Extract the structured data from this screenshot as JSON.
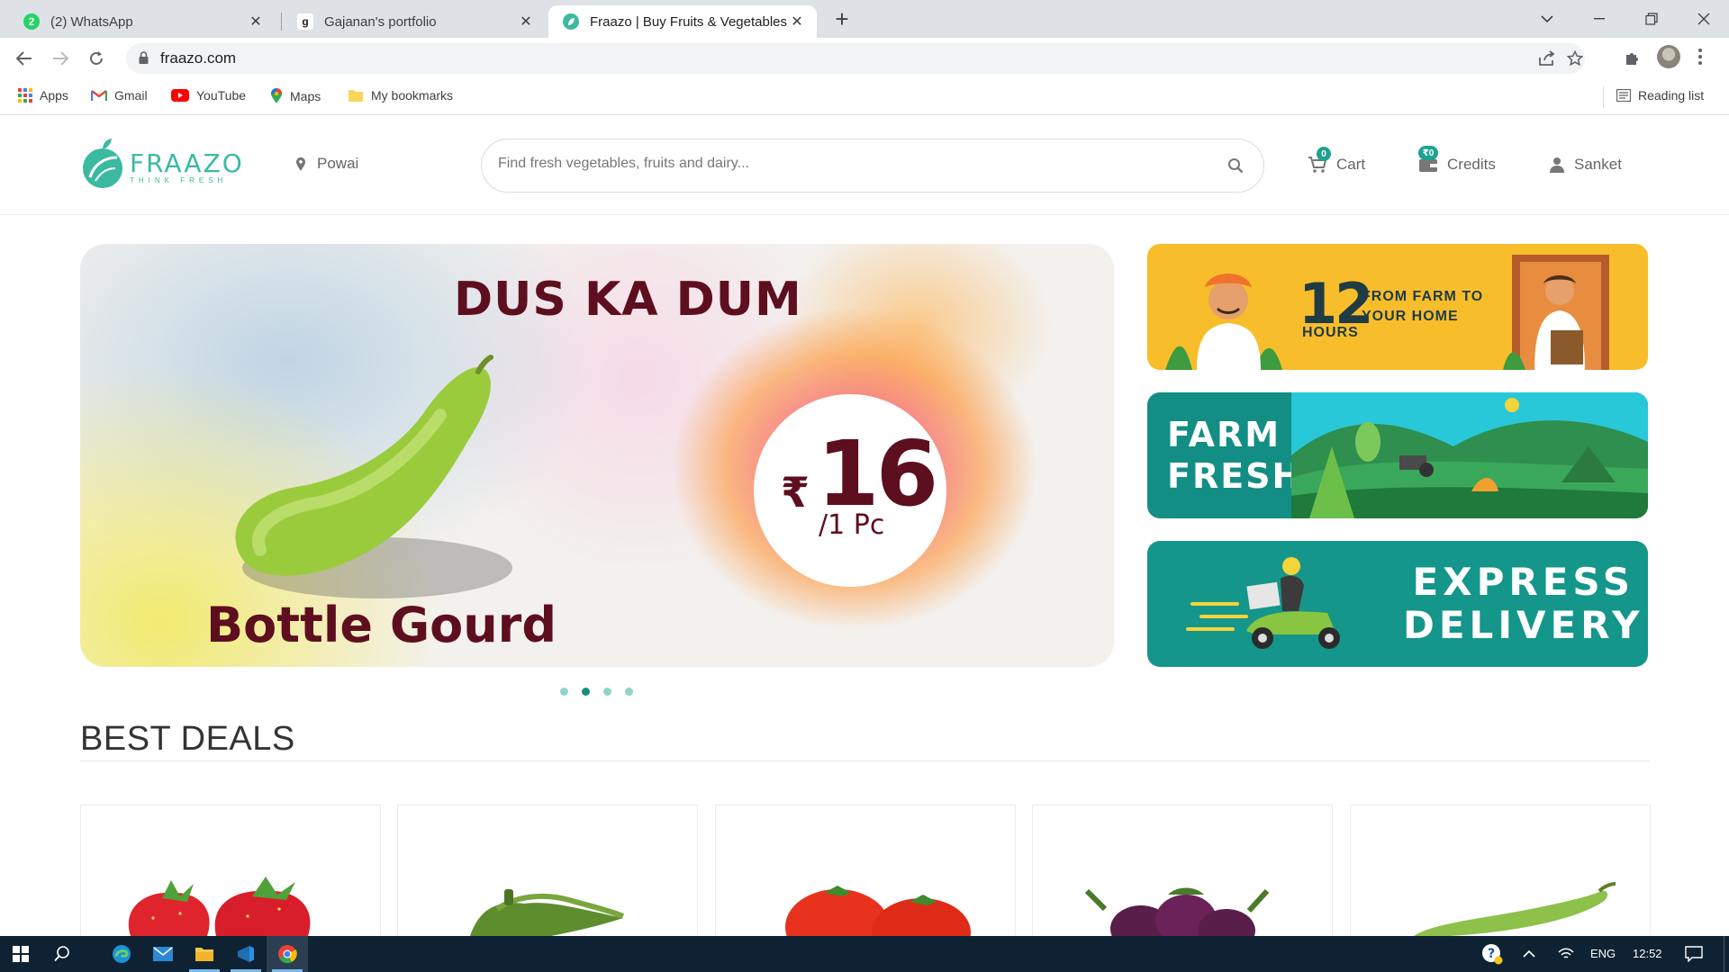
{
  "browser": {
    "tabs": [
      {
        "title": "(2) WhatsApp",
        "favicon_icon": "whatsapp-icon",
        "badge": "2"
      },
      {
        "title": "Gajanan's portfolio",
        "favicon_icon": "g-letter-icon"
      },
      {
        "title": "Fraazo | Buy Fruits & Vegetables",
        "favicon_icon": "fraazo-leaf-icon",
        "active": true
      }
    ],
    "url": "fraazo.com",
    "bookmarks": [
      {
        "label": "Apps",
        "icon": "apps-grid-icon"
      },
      {
        "label": "Gmail",
        "icon": "gmail-icon"
      },
      {
        "label": "YouTube",
        "icon": "youtube-icon"
      },
      {
        "label": "Maps",
        "icon": "maps-pin-icon"
      },
      {
        "label": "My bookmarks",
        "icon": "folder-icon"
      }
    ],
    "reading_list": "Reading list"
  },
  "site": {
    "logo_name": "FRAAZO",
    "logo_tagline": "THINK FRESH",
    "location": "Powai",
    "search_placeholder": "Find fresh vegetables, fruits and dairy...",
    "cart_label": "Cart",
    "cart_count": "0",
    "credits_label": "Credits",
    "credits_value": "₹0",
    "user_name": "Sanket",
    "accent_color": "#3bb9a1"
  },
  "hero": {
    "title": "DUS KA DUM",
    "product": "Bottle Gourd",
    "currency": "₹",
    "price": "16",
    "unit": "/1 Pc",
    "slides": 4,
    "active_slide": 2
  },
  "banners": {
    "farm": {
      "number": "12",
      "line": "FROM FARM TO YOUR HOME",
      "hours": "HOURS"
    },
    "fresh": {
      "line1": "FARM",
      "line2": "FRESH"
    },
    "express": {
      "line1": "EXPRESS",
      "line2": "DELIVERY"
    }
  },
  "best_deals": {
    "title": "BEST DEALS",
    "items": [
      "strawberry",
      "okra",
      "tomato",
      "brinjal",
      "bottle gourd"
    ]
  },
  "taskbar": {
    "language": "ENG",
    "time": "12:52"
  }
}
